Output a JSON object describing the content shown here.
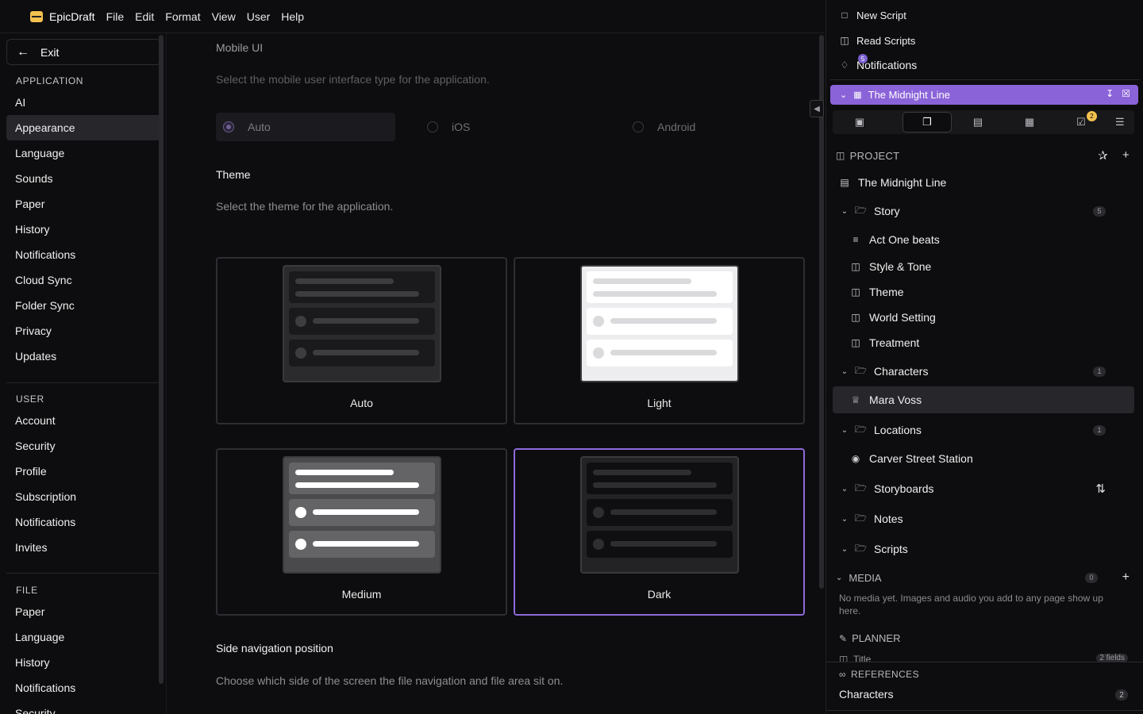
{
  "menubar": {
    "app_name": "EpicDraft",
    "items": [
      "File",
      "Edit",
      "Format",
      "View",
      "User",
      "Help"
    ]
  },
  "sidebar": {
    "exit_label": "Exit",
    "sections": [
      {
        "title": "APPLICATION",
        "items": [
          "AI",
          "Appearance",
          "Language",
          "Sounds",
          "Paper",
          "History",
          "Notifications",
          "Cloud Sync",
          "Folder Sync",
          "Privacy",
          "Updates"
        ],
        "active": "Appearance"
      },
      {
        "title": "USER",
        "items": [
          "Account",
          "Security",
          "Profile",
          "Subscription",
          "Notifications",
          "Invites"
        ]
      },
      {
        "title": "FILE",
        "items": [
          "Paper",
          "Language",
          "History",
          "Notifications",
          "Security"
        ]
      }
    ]
  },
  "main": {
    "mobile_ui": {
      "title": "Mobile UI",
      "description": "Select the mobile user interface type for the application.",
      "options": [
        "Auto",
        "iOS",
        "Android"
      ],
      "selected": "Auto"
    },
    "theme": {
      "title": "Theme",
      "description": "Select the theme for the application.",
      "options": [
        "Auto",
        "Light",
        "Medium",
        "Dark"
      ],
      "selected": "Dark"
    },
    "side_nav": {
      "title": "Side navigation position",
      "description": "Choose which side of the screen the file navigation and file area sit on."
    }
  },
  "right_panel": {
    "links": [
      "New Script",
      "Read Scripts",
      "Notifications"
    ],
    "notification_count": "5",
    "project_bar_title": "The Midnight Line",
    "tab_badge": "2",
    "project_header": "PROJECT",
    "tree": [
      {
        "label": "The Midnight Line",
        "icon": "clapperboard-icon",
        "level": 0,
        "chevron": false
      },
      {
        "label": "Story",
        "icon": "folder-icon",
        "level": 0,
        "chevron": true,
        "count": "5"
      },
      {
        "label": "Act One beats",
        "icon": "outline-icon",
        "level": 1
      },
      {
        "label": "Style & Tone",
        "icon": "book-icon",
        "level": 1
      },
      {
        "label": "Theme",
        "icon": "book-icon",
        "level": 1
      },
      {
        "label": "World Setting",
        "icon": "book-icon",
        "level": 1
      },
      {
        "label": "Treatment",
        "icon": "book-icon",
        "level": 1
      },
      {
        "label": "Characters",
        "icon": "folder-icon",
        "level": 0,
        "chevron": true,
        "count": "1"
      },
      {
        "label": "Mara Voss",
        "icon": "crown-icon",
        "level": 1,
        "active": true
      },
      {
        "label": "Locations",
        "icon": "folder-icon",
        "level": 0,
        "chevron": true,
        "count": "1"
      },
      {
        "label": "Carver Street Station",
        "icon": "pin-icon",
        "level": 1
      },
      {
        "label": "Storyboards",
        "icon": "folder-icon",
        "level": 0,
        "chevron": true,
        "action": "sort-icon"
      },
      {
        "label": "Notes",
        "icon": "folder-icon",
        "level": 0,
        "chevron": true
      },
      {
        "label": "Scripts",
        "icon": "folder-icon",
        "level": 0,
        "chevron": true
      }
    ],
    "media": {
      "title": "MEDIA",
      "count": "0",
      "empty_text": "No media yet. Images and audio you add to any page show up here."
    },
    "planner": {
      "title": "PLANNER",
      "peek_label": "Title",
      "peek_fields": "2 fields"
    },
    "references": {
      "title": "REFERENCES",
      "item": "Characters",
      "count": "2"
    }
  },
  "colors": {
    "accent": "#8b63d9",
    "background": "#0d0d0f",
    "badge_yellow": "#f2c14e"
  }
}
